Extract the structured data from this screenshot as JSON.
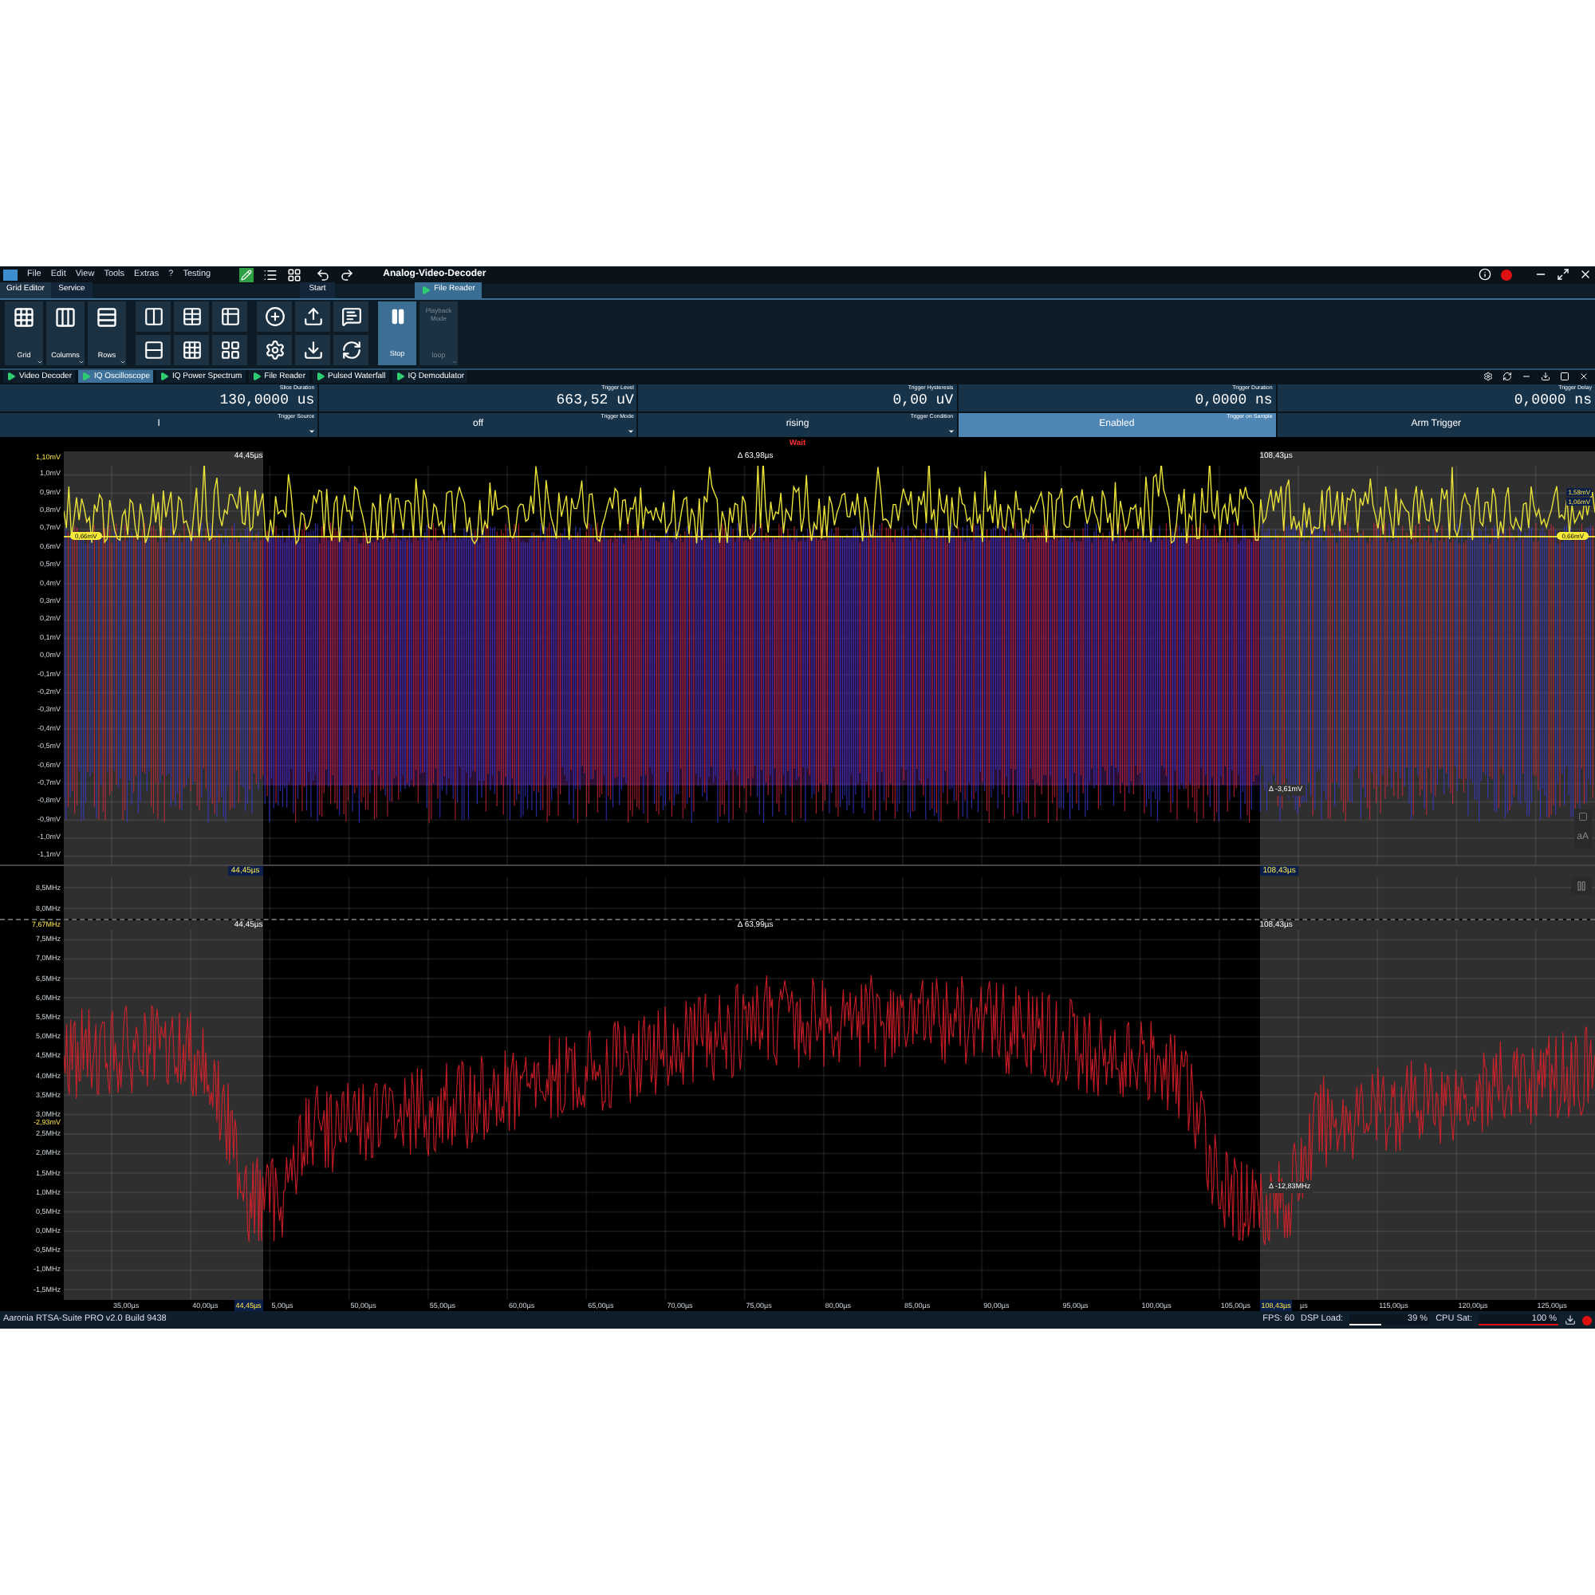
{
  "window": {
    "title": "Analog-Video-Decoder"
  },
  "menu": [
    "File",
    "Edit",
    "View",
    "Tools",
    "Extras",
    "?",
    "Testing"
  ],
  "ribbon_tabs": [
    {
      "label": "Grid Editor",
      "selected": true
    },
    {
      "label": "Service",
      "selected": false
    },
    {
      "label": "Start",
      "selected": false
    },
    {
      "label": "File Reader",
      "selected": true
    }
  ],
  "ribbon_buttons": [
    {
      "label": "Grid",
      "dropdown": true
    },
    {
      "label": "Columns",
      "dropdown": true
    },
    {
      "label": "Rows",
      "dropdown": true
    }
  ],
  "playback": {
    "stop": {
      "label": "Stop",
      "active": true
    },
    "mode": {
      "title": "Playback Mode",
      "value": "loop",
      "disabled": true
    }
  },
  "view_tabs": [
    {
      "label": "Video Decoder",
      "selected": false
    },
    {
      "label": "IQ Oscilloscope",
      "selected": true
    },
    {
      "label": "IQ Power Spectrum",
      "selected": false
    },
    {
      "label": "File Reader",
      "selected": false
    },
    {
      "label": "Pulsed Waterfall",
      "selected": false
    },
    {
      "label": "IQ Demodulator",
      "selected": false
    }
  ],
  "params": [
    {
      "label": "Slice Duration",
      "value": "130,0000 us"
    },
    {
      "label": "Trigger Level",
      "value": "663,52 uV"
    },
    {
      "label": "Trigger Hysteresis",
      "value": "0,00 uV"
    },
    {
      "label": "Trigger Duration",
      "value": "0,0000 ns"
    },
    {
      "label": "Trigger Delay",
      "value": "0,0000 ns"
    }
  ],
  "controls": [
    {
      "kind": "dropdown",
      "label": "Trigger Source",
      "value": "I"
    },
    {
      "kind": "dropdown",
      "label": "Trigger Mode",
      "value": "off"
    },
    {
      "kind": "dropdown",
      "label": "Trigger Condition",
      "value": "rising"
    },
    {
      "kind": "toggle",
      "label": "Trigger on Sample",
      "value": "Enabled",
      "on": true
    },
    {
      "kind": "button",
      "value": "Arm Trigger"
    }
  ],
  "trigger_status": "Wait",
  "oscilloscope": {
    "top_label": "1,10mV",
    "yticks": [
      "1,0mV",
      "0,9mV",
      "0,8mV",
      "0,7mV",
      "0,6mV",
      "0,5mV",
      "0,4mV",
      "0,3mV",
      "0,2mV",
      "0,1mV",
      "0,0mV",
      "-0,1mV",
      "-0,2mV",
      "-0,3mV",
      "-0,4mV",
      "-0,5mV",
      "-0,6mV",
      "-0,7mV",
      "-0,8mV",
      "-0,9mV",
      "-1,0mV",
      "-1,1mV"
    ],
    "cursor_left": "44,45µs",
    "cursor_delta": "Δ 63,98µs",
    "cursor_right": "108,43µs",
    "trigger_marker_left": "0,66mV",
    "trigger_marker_right": "0,66mV",
    "delta_value": "Δ -3,61mV",
    "readout": [
      "1,58mV",
      "1,06mV"
    ]
  },
  "spectrum_strip": {
    "yticks": [
      "8,5MHz",
      "8,0MHz"
    ],
    "cursor_left": "44,45µs",
    "cursor_right": "108,43µs"
  },
  "spectrum": {
    "top_label": "7,67MHz",
    "yticks": [
      "7,5MHz",
      "7,0MHz",
      "6,5MHz",
      "6,0MHz",
      "5,5MHz",
      "5,0MHz",
      "4,5MHz",
      "4,0MHz",
      "3,5MHz",
      "3,0MHz",
      "2,5MHz",
      "2,0MHz",
      "1,5MHz",
      "1,0MHz",
      "0,5MHz",
      "0,0MHz",
      "-0,5MHz",
      "-1,0MHz",
      "-1,5MHz"
    ],
    "cursor_left": "44,45µs",
    "cursor_delta": "Δ 63,99µs",
    "cursor_right": "108,43µs",
    "marker": "-2,93mV",
    "delta_value": "Δ -12,83MHz"
  },
  "xaxis": {
    "ticks": [
      "35,00µs",
      "40,00µs",
      "5,00µs",
      "50,00µs",
      "55,00µs",
      "60,00µs",
      "65,00µs",
      "70,00µs",
      "75,00µs",
      "80,00µs",
      "85,00µs",
      "90,00µs",
      "95,00µs",
      "100,00µs",
      "105,00µs",
      "µs",
      "115,00µs",
      "120,00µs",
      "125,00µs"
    ],
    "cursor_left": "44,45µs",
    "cursor_right": "108,43µs"
  },
  "side_tools": {
    "text_size": "aA"
  },
  "status_bar": {
    "version": "Aaronia RTSA-Suite PRO v2.0 Build 9438",
    "fps": "FPS: 60",
    "dsp_label": "DSP Load:",
    "dsp": {
      "level": 0.39,
      "reading": "39 %"
    },
    "cpu_label": "CPU Sat:",
    "cpu": {
      "level": 1.0,
      "reading": "100 %"
    }
  }
}
